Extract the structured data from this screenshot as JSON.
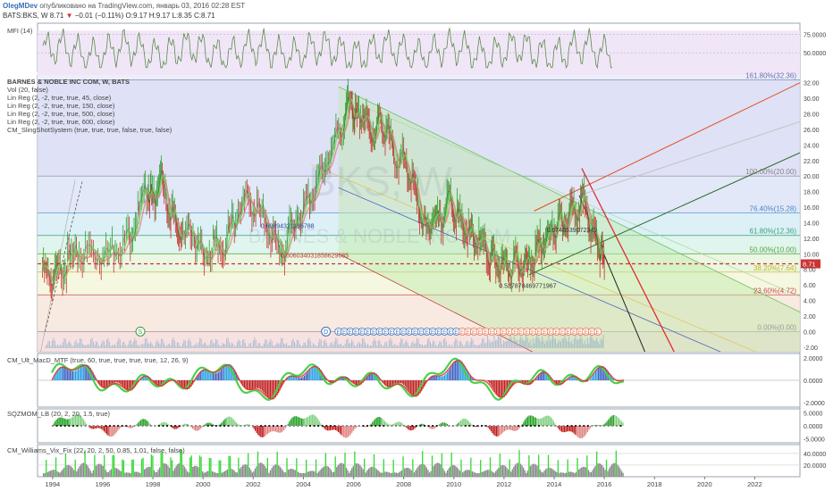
{
  "header": {
    "author": "OlegMDev",
    "published": "опубликовано на TradingView.com, январь 03, 2016 02:28 EST",
    "symbol": "BATS:BKS, W",
    "last": "8.71",
    "change": "−0.01 (−0.11%)",
    "ohlc": "O:9.17 H:9.17 L:8.35 C:8.71"
  },
  "main_legend": [
    "BARNES & NOBLE INC COM, W, BATS",
    "Vol (20, false)",
    "Lin Reg (2, -2, true, true, 45, close)",
    "Lin Reg (2, -2, true, true, 150, close)",
    "Lin Reg (2, -2, true, true, 500, close)",
    "Lin Reg (2, -2, true, true, 600, close)",
    "CM_SlingShotSystem (true, true, true, false, true, false)"
  ],
  "panel_labels": {
    "mfi": "MFI (14)",
    "macd": "CM_Ult_MacD_MTF (true, 60, true, true, true, true, 12, 26, 9)",
    "sqz": "SQZMOM_LB (20, 2, 20, 1.5, true)",
    "vix": "CM_Williams_Vix_Fix (22, 20, 2, 50, 0.85, 1.01, false, false)"
  },
  "watermark": [
    "BKS, W",
    "BARNES & NOBLE INC COM"
  ],
  "colors": {
    "accent": "#3a6fb5",
    "down": "#d32f2f",
    "up": "#2e9e2e",
    "price_line": "#cc3333"
  },
  "chart_data": [
    {
      "type": "line",
      "title": "MFI (14)",
      "y_ticks": [
        "75.0000",
        "50.0000"
      ],
      "ylim": [
        25,
        90
      ],
      "note_lines": [
        80,
        20
      ]
    },
    {
      "type": "line",
      "title": "BARNES & NOBLE INC COM, W, BATS",
      "x_ticks": [
        "1994",
        "1996",
        "1998",
        "2000",
        "2002",
        "2004",
        "2006",
        "2008",
        "2010",
        "2012",
        "2014",
        "2016",
        "2018",
        "2020",
        "2022"
      ],
      "xlim": [
        1993.4,
        2023.8
      ],
      "y_ticks": [
        "32.00",
        "30.00",
        "28.00",
        "26.00",
        "24.00",
        "22.00",
        "20.00",
        "18.00",
        "16.00",
        "14.00",
        "12.00",
        "10.00",
        "8.00",
        "6.00",
        "4.00",
        "2.00",
        "0.00",
        "-2.00"
      ],
      "ylim": [
        -2.6,
        33
      ],
      "series": [
        {
          "x": [
            1993.6,
            1993.9,
            1994.2,
            1994.6,
            1995,
            1995.5,
            1996,
            1996.5,
            1997,
            1997.4,
            1997.8,
            1998,
            1998.3,
            1998.6,
            1998.9,
            1999.2,
            1999.6,
            2000,
            2000.4,
            2000.8,
            2001.2,
            2001.6,
            2002,
            2002.4,
            2002.8,
            2003.2,
            2003.6,
            2004,
            2004.4,
            2004.8,
            2005.2,
            2005.6,
            2005.9,
            2006.1,
            2006.4,
            2006.7,
            2007,
            2007.3,
            2007.6,
            2008,
            2008.3,
            2008.6,
            2008.9,
            2009.2,
            2009.5,
            2009.8,
            2010.1,
            2010.4,
            2010.7,
            2011,
            2011.3,
            2011.6,
            2011.9,
            2012.2,
            2012.5,
            2012.8,
            2013.1,
            2013.4,
            2013.7,
            2014,
            2014.3,
            2014.6,
            2014.9,
            2015.2,
            2015.5,
            2015.8,
            2016
          ],
          "y": [
            8,
            6.5,
            7.5,
            9,
            9.5,
            10.5,
            9.5,
            11,
            12,
            15,
            18.5,
            17,
            20,
            16,
            14,
            12,
            13,
            9.5,
            11,
            10.5,
            14,
            17,
            16,
            15,
            12,
            10,
            14,
            16,
            18,
            21,
            24,
            27,
            30,
            27,
            28,
            25,
            27,
            26,
            23,
            22,
            20,
            16,
            13,
            15,
            14,
            17,
            15,
            13,
            12,
            11.5,
            10,
            9,
            8.5,
            8,
            9.5,
            8,
            9,
            11,
            12,
            13,
            14,
            15,
            16,
            17,
            13,
            11,
            8.71
          ]
        }
      ],
      "fib_levels": [
        {
          "label": "161.80%(32.36)",
          "value": 32.36
        },
        {
          "label": "100.00%(20.00)",
          "value": 20.0
        },
        {
          "label": "76.40%(15.28)",
          "value": 15.28
        },
        {
          "label": "61.80%(12.36)",
          "value": 12.36
        },
        {
          "label": "50.00%(10.00)",
          "value": 10.0
        },
        {
          "label": "38.20%(7.64)",
          "value": 7.64
        },
        {
          "label": "23.60%(4.72)",
          "value": 4.72
        },
        {
          "label": "0.00%(0.00)",
          "value": 0.0
        }
      ],
      "annotations": [
        "0.69894321196788",
        "0.606034031858629685",
        "0.6746539072349",
        "0.527878469771967"
      ],
      "price_line": {
        "label": "8.71",
        "value": 8.71
      }
    },
    {
      "type": "bar",
      "title": "CM_Ult_MacD_MTF",
      "y_ticks": [
        "2.0000",
        "0.0000",
        "-2.0000"
      ],
      "ylim": [
        -2.4,
        2.4
      ]
    },
    {
      "type": "bar",
      "title": "SQZMOM_LB",
      "y_ticks": [
        "5.0000",
        "0.0000",
        "-5.0000"
      ],
      "ylim": [
        -6.5,
        6.5
      ]
    },
    {
      "type": "bar",
      "title": "CM_Williams_Vix_Fix",
      "y_ticks": [
        "40.0000",
        "20.0000"
      ],
      "ylim": [
        0,
        55
      ]
    }
  ]
}
